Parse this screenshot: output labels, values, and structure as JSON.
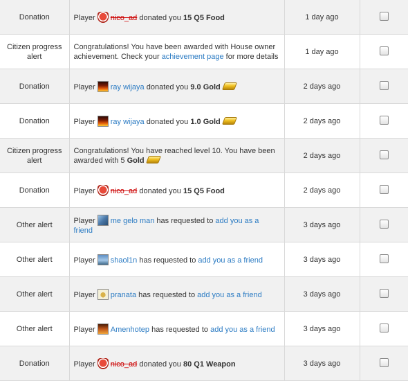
{
  "alerts": [
    {
      "type": "Donation",
      "prefix": "Player",
      "user": "nico_ad",
      "middle": "donated you",
      "item": "15 Q5 Food",
      "date": "1 day ago"
    },
    {
      "type": "Citizen progress alert",
      "text": "Congratulations! You have been awarded with House owner achievement. Check your",
      "link": "achievement page",
      "suffix": "for more details",
      "date": "1 day ago"
    },
    {
      "type": "Donation",
      "prefix": "Player",
      "user": "ray wijaya",
      "middle": "donated you",
      "item": "9.0 Gold",
      "date": "2 days ago"
    },
    {
      "type": "Donation",
      "prefix": "Player",
      "user": "ray wijaya",
      "middle": "donated you",
      "item": "1.0 Gold",
      "date": "2 days ago"
    },
    {
      "type": "Citizen progress alert",
      "text": "Congratulations! You have reached level 10. You have been awarded with 5",
      "item": "Gold",
      "date": "2 days ago"
    },
    {
      "type": "Donation",
      "prefix": "Player",
      "user": "nico_ad",
      "middle": "donated you",
      "item": "15 Q5 Food",
      "date": "2 days ago"
    },
    {
      "type": "Other alert",
      "prefix": "Player",
      "user": "me gelo man",
      "middle": "has requested to",
      "link": "add you as a friend",
      "date": "3 days ago"
    },
    {
      "type": "Other alert",
      "prefix": "Player",
      "user": "shaol1n",
      "middle": "has requested to",
      "link": "add you as a friend",
      "date": "3 days ago"
    },
    {
      "type": "Other alert",
      "prefix": "Player",
      "user": "pranata",
      "middle": "has requested to",
      "link": "add you as a friend",
      "date": "3 days ago"
    },
    {
      "type": "Other alert",
      "prefix": "Player",
      "user": "Amenhotep",
      "middle": "has requested to",
      "link": "add you as a friend",
      "date": "3 days ago"
    },
    {
      "type": "Donation",
      "prefix": "Player",
      "user": "nico_ad",
      "middle": "donated you",
      "item": "80 Q1 Weapon",
      "date": "3 days ago"
    }
  ],
  "icons": {
    "nico_ad": "shield-avatar-icon",
    "ray_wijaya": "fire-avatar-icon",
    "me_gelo_man": "sky-avatar-icon",
    "shaol1n": "landscape-avatar-icon",
    "pranata": "cat-avatar-icon",
    "Amenhotep": "amenhotep-avatar-icon",
    "gold": "gold-bar-icon",
    "checkbox": "unchecked-checkbox"
  }
}
